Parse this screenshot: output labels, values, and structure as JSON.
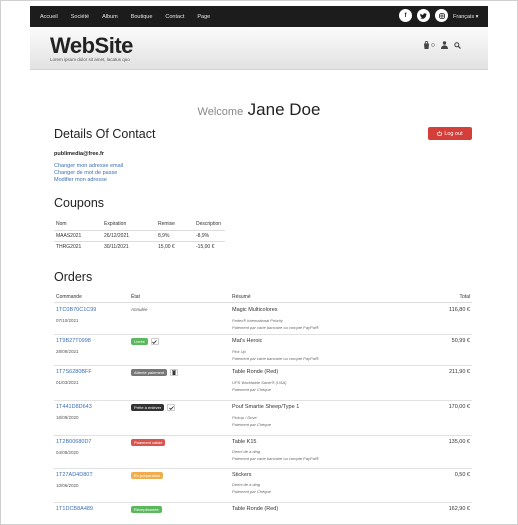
{
  "topnav": {
    "items": [
      "Accueil",
      "Société",
      "Album",
      "Boutique",
      "Contact",
      "Page"
    ],
    "social_icons": [
      "facebook-icon",
      "twitter-icon",
      "instagram-icon"
    ],
    "language": "Français ▾"
  },
  "header": {
    "logo": "WebSite",
    "tagline": "Lorem ipsum dolor sit amet, lacatus quo",
    "icons": [
      "cart-icon",
      "user-icon",
      "search-icon"
    ]
  },
  "welcome": {
    "label": "Welcome",
    "name": "Jane Doe"
  },
  "contact": {
    "title": "Details Of Contact",
    "logout_label": "Log out",
    "email": "publimedia@free.fr",
    "links": [
      "Changer mon adresse email",
      "Changer de mot de passe",
      "Modifier mon adresse"
    ]
  },
  "coupons": {
    "title": "Coupons",
    "headers": [
      "Nom",
      "Expiration",
      "Remise",
      "Description"
    ],
    "rows": [
      [
        "MAAS2021",
        "26/12/2021",
        "8,9%",
        "-8,9%"
      ],
      [
        "THRG2021",
        "30/11/2021",
        "15,00 €",
        "-15,00 €"
      ]
    ]
  },
  "orders": {
    "title": "Orders",
    "headers": {
      "commande": "Commande",
      "etat": "État",
      "resume": "Résumé",
      "total": "Total"
    },
    "items": [
      {
        "number": "1TC0B70C1C99",
        "date": "07/10/2021",
        "state": "Annulée",
        "resume": "Magic Multicolores",
        "sub": [
          "Fedex® International Priority",
          "Paiement par carte bancaire ou compte PayPal®"
        ],
        "total": "116,80 €"
      },
      {
        "number": "1T9B27T0998",
        "date": "28/09/2021",
        "state": "Livrée",
        "state_color": "#5cb85c",
        "resume": "Mat's Heroic",
        "sub": [
          "Pick Up",
          "Paiement par carte bancaire ou compte PayPal®"
        ],
        "total": "50,99 €"
      },
      {
        "number": "1T7S6280BFF",
        "date": "01/03/2021",
        "state": "Attente paiement",
        "state_color": "#777777",
        "resume": "Table Ronde (Red)",
        "sub": [
          "UPS Worldwide Saver® (USA)",
          "Paiement par Chèque"
        ],
        "total": "211,90 €"
      },
      {
        "number": "1T441D8D643",
        "date": "18/09/2020",
        "state": "Prête à enlever",
        "state_color": "#333333",
        "resume": "Pouf Smartie Sheep/Type 1",
        "sub": [
          "Pickup / Drive",
          "Paiement par Chèque"
        ],
        "total": "170,00 €"
      },
      {
        "number": "1T2B00680D7",
        "date": "04/08/2020",
        "state": "Paiement validé",
        "state_color": "#d9534f",
        "resume": "Table K15",
        "sub": [
          "Direct de à ding",
          "Paiement par carte bancaire ou compte PayPal®"
        ],
        "total": "135,00 €"
      },
      {
        "number": "1T27AD4D80T",
        "date": "10/06/2020",
        "state": "En préparation",
        "state_color": "#f0ad4e",
        "resume": "Stickers",
        "sub": [
          "Direct de à ding",
          "Paiement par Chèque"
        ],
        "total": "0,50 €"
      },
      {
        "number": "1T1DCB8A489",
        "date": "",
        "state": "Réceptionnée",
        "state_color": "#5cb85c",
        "resume": "Table Ronde (Red)",
        "sub": [],
        "total": "162,90 €"
      }
    ]
  }
}
